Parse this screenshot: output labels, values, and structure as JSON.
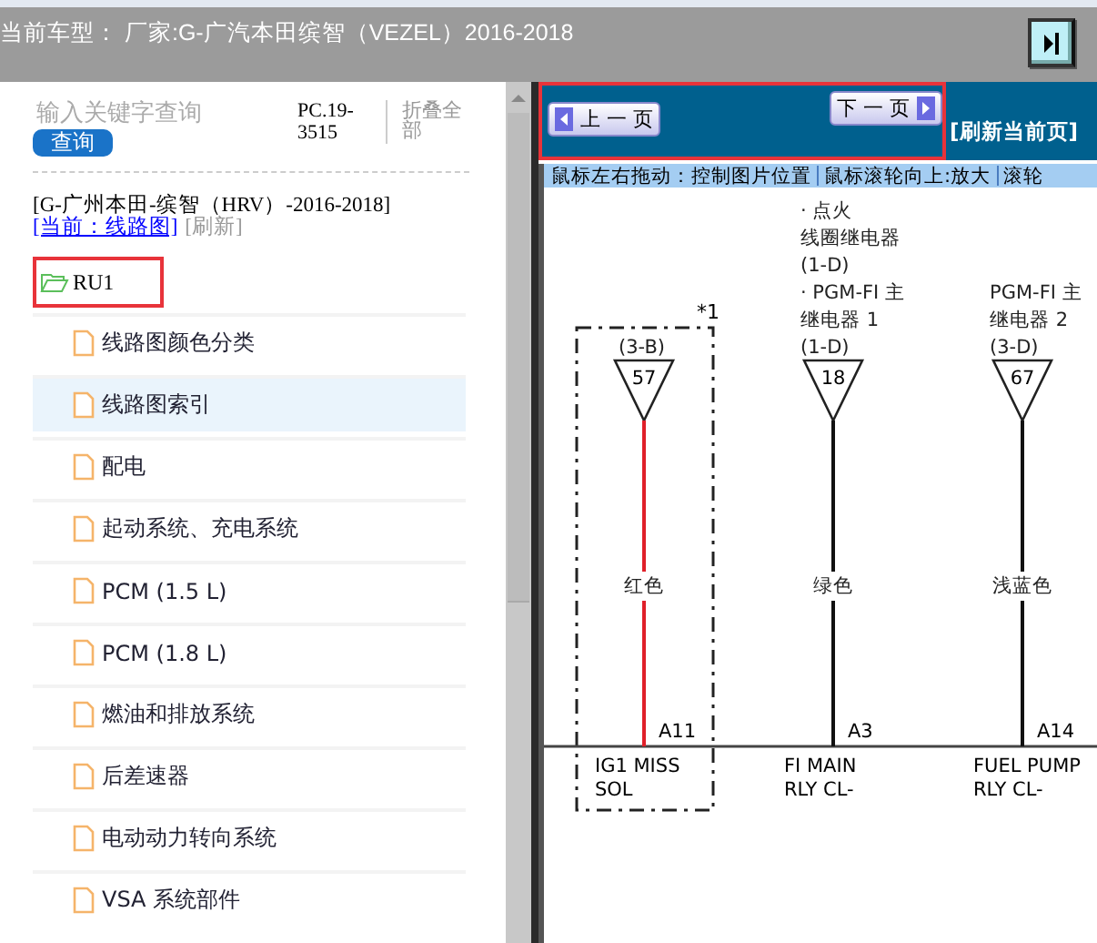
{
  "header": {
    "title": "当前车型：  厂家:G-广汽本田缤智（VEZEL）2016-2018"
  },
  "search": {
    "placeholder": "输入关键字查询",
    "button": "查询",
    "code": "PC.19-3515",
    "collapse": "折叠全部"
  },
  "breadcrumb": {
    "model": "[G-广州本田-缤智（HRV）-2016-2018]",
    "current": "[当前：线路图]",
    "refresh": "[刷新]"
  },
  "tree": {
    "label": "RU1",
    "expanded": true,
    "children": [
      {
        "label": "线路图颜色分类",
        "selected": false
      },
      {
        "label": "线路图索引",
        "selected": true
      },
      {
        "label": "配电",
        "selected": false
      },
      {
        "label": "起动系统、充电系统",
        "selected": false
      },
      {
        "label": "PCM (1.5 L)",
        "selected": false
      },
      {
        "label": "PCM (1.8 L)",
        "selected": false
      },
      {
        "label": "燃油和排放系统",
        "selected": false
      },
      {
        "label": "后差速器",
        "selected": false
      },
      {
        "label": "电动动力转向系统",
        "selected": false
      },
      {
        "label": "VSA 系统部件",
        "selected": false
      }
    ]
  },
  "nav": {
    "prev": "上 一 页",
    "next": "下 一 页",
    "refresh": "[刷新当前页]"
  },
  "hints": [
    "鼠标左右拖动：控制图片位置",
    "鼠标滚轮向上:放大",
    "滚轮"
  ],
  "diagram": {
    "note": "*1",
    "connectors": [
      {
        "source": [
          "(3-B)"
        ],
        "pin": "57",
        "wire_color": "红色",
        "color": "#e0202a",
        "terminal": "A11",
        "name": [
          "IG1 MISS",
          "SOL"
        ]
      },
      {
        "source": [
          "· 点火",
          "线圈继电器",
          "(1-D)",
          "· PGM-FI 主",
          "继电器 1",
          "(1-D)"
        ],
        "pin": "18",
        "wire_color": "绿色",
        "color": "#111111",
        "terminal": "A3",
        "name": [
          "FI MAIN",
          "RLY CL-"
        ]
      },
      {
        "source": [
          "PGM-FI 主",
          "继电器 2",
          "(3-D)"
        ],
        "pin": "67",
        "wire_color": "浅蓝色",
        "color": "#111111",
        "terminal": "A14",
        "name": [
          "FUEL PUMP",
          "RLY CL-"
        ]
      }
    ]
  }
}
